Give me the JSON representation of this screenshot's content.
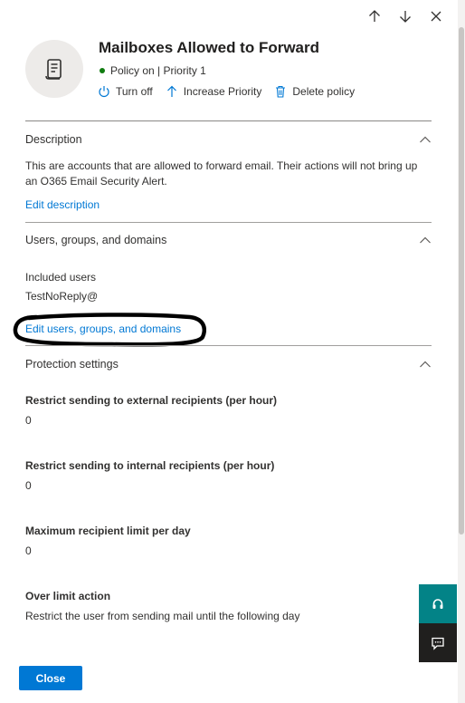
{
  "panel": {
    "title": "Mailboxes Allowed to Forward",
    "status": "Policy on | Priority 1",
    "status_color": "#107c10",
    "icon": "policy-scroll-icon"
  },
  "actions": {
    "turn_off": "Turn off",
    "increase_priority": "Increase Priority",
    "delete_policy": "Delete policy"
  },
  "nav_icons": [
    "arrow-up-icon",
    "arrow-down-icon",
    "close-icon"
  ],
  "description": {
    "header": "Description",
    "text": "This are accounts that are allowed to forward email. Their actions will not bring up an O365 Email Security Alert.",
    "edit_link": "Edit description"
  },
  "users": {
    "header": "Users, groups, and domains",
    "included_label": "Included users",
    "included_value": "TestNoReply@",
    "edit_link": "Edit users, groups, and domains"
  },
  "protection": {
    "header": "Protection settings",
    "settings": [
      {
        "label": "Restrict sending to external recipients (per hour)",
        "value": "0"
      },
      {
        "label": "Restrict sending to internal recipients (per hour)",
        "value": "0"
      },
      {
        "label": "Maximum recipient limit per day",
        "value": "0"
      },
      {
        "label": "Over limit action",
        "value": "Restrict the user from sending mail until the following day"
      }
    ]
  },
  "footer": {
    "close_label": "Close"
  },
  "colors": {
    "accent": "#0078d4",
    "teal": "#038387",
    "dark": "#201f1e"
  }
}
